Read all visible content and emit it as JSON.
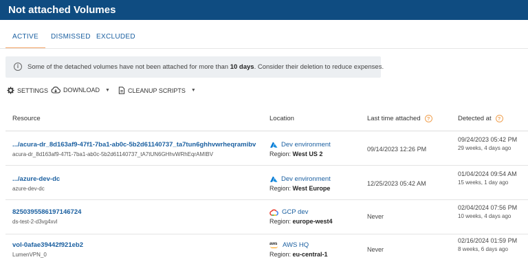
{
  "header": {
    "title": "Not attached Volumes"
  },
  "tabs": [
    {
      "label": "ACTIVE"
    },
    {
      "label": "DISMISSED"
    },
    {
      "label": "EXCLUDED"
    }
  ],
  "alert": {
    "text_before": "Some of the detached volumes have not been attached for more than ",
    "highlight": "10 days",
    "text_after": ". Consider their deletion to reduce expenses."
  },
  "toolbar": {
    "settings": "SETTINGS",
    "download": "DOWNLOAD",
    "cleanup": "CLEANUP SCRIPTS"
  },
  "columns": {
    "resource": "Resource",
    "location": "Location",
    "last_attached": "Last time attached",
    "detected": "Detected at"
  },
  "rows": [
    {
      "resource": ".../acura-dr_8d163af9-47f1-7ba1-ab0c-5b2d61140737_ta7tun6ghhvwrheqramibv",
      "resource_sub": "acura-dr_8d163af9-47f1-7ba1-ab0c-5b2d61140737_tA7tUN6GHhvWRhEqrAMIBV",
      "provider": "azure",
      "location": "Dev environment",
      "region_label": "Region:",
      "region": "West US 2",
      "last_attached": "09/14/2023 12:26 PM",
      "detected": "09/24/2023 05:42 PM",
      "detected_ago": "29 weeks, 4 days ago"
    },
    {
      "resource": ".../azure-dev-dc",
      "resource_sub": "azure-dev-dc",
      "provider": "azure",
      "location": "Dev environment",
      "region_label": "Region:",
      "region": "West Europe",
      "last_attached": "12/25/2023 05:42 AM",
      "detected": "01/04/2024 09:54 AM",
      "detected_ago": "15 weeks, 1 day ago"
    },
    {
      "resource": "8250395586197146724",
      "resource_sub": "ds-test-2-d3vg4xvl",
      "provider": "gcp",
      "location": "GCP dev",
      "region_label": "Region:",
      "region": "europe-west4",
      "last_attached": "Never",
      "detected": "02/04/2024 07:56 PM",
      "detected_ago": "10 weeks, 4 days ago"
    },
    {
      "resource": "vol-0afae39442f921eb2",
      "resource_sub": "LumenVPN_0",
      "provider": "aws",
      "location": "AWS HQ",
      "region_label": "Region:",
      "region": "eu-central-1",
      "last_attached": "Never",
      "detected": "02/16/2024 01:59 PM",
      "detected_ago": "8 weeks, 6 days ago"
    }
  ],
  "icons": {
    "info": "info-icon",
    "settings": "gear-icon",
    "download": "cloud-download-icon",
    "cleanup": "document-icon",
    "help": "help-icon",
    "aws_logo_text": "aws"
  },
  "colors": {
    "header_bg": "#0f4c81",
    "link": "#1a5fa0",
    "accent": "#f3a263",
    "alert_bg": "#eceff2"
  }
}
